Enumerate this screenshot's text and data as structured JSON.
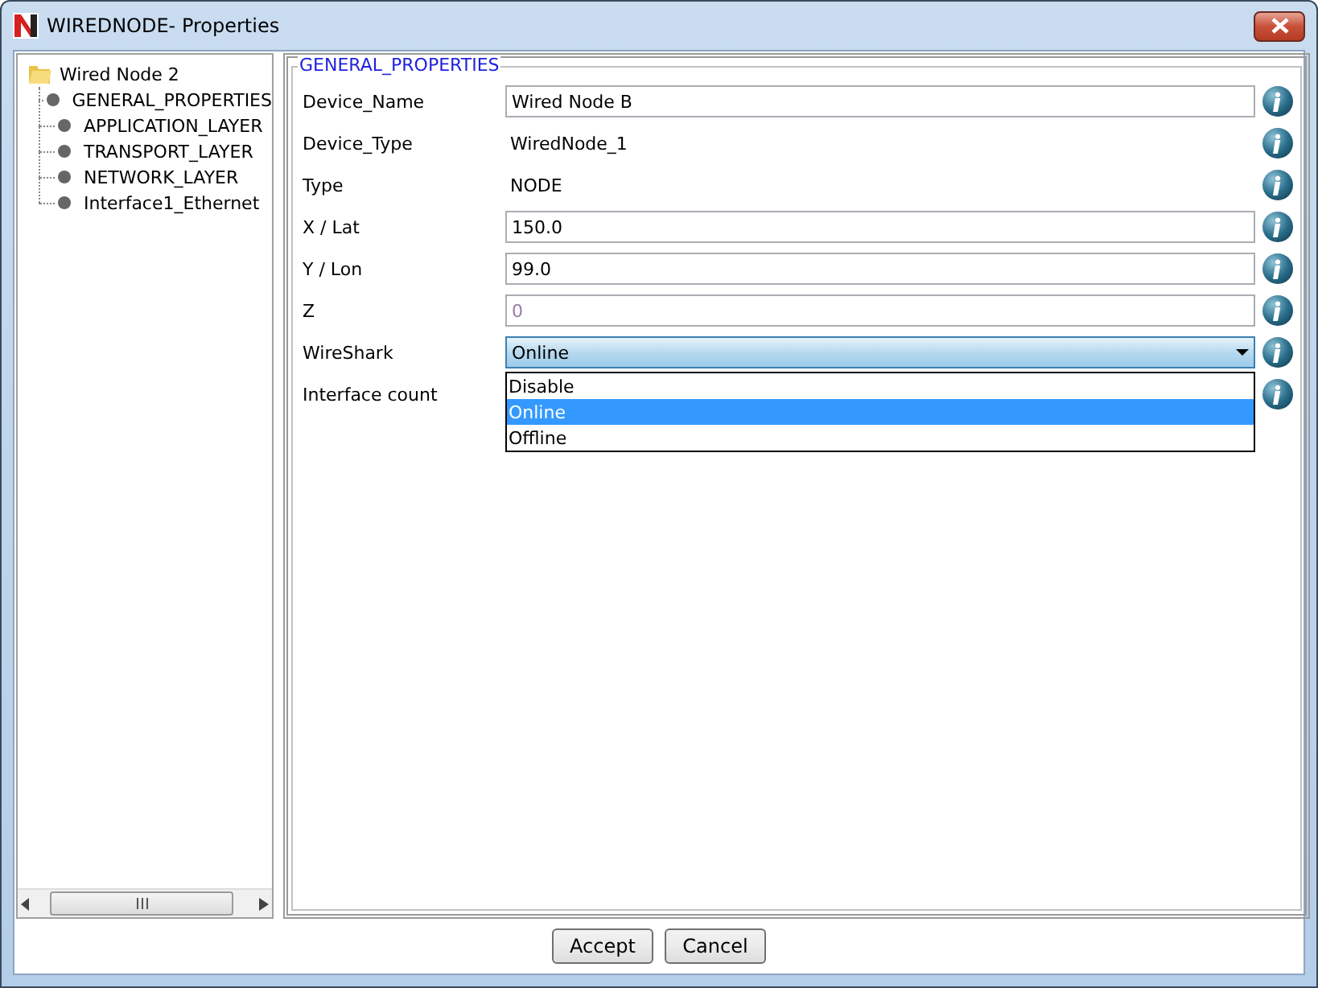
{
  "window": {
    "title": "WIREDNODE- Properties"
  },
  "tree": {
    "label": "Wired Node 2",
    "expanded": true,
    "children": [
      {
        "label": "GENERAL_PROPERTIES"
      },
      {
        "label": "APPLICATION_LAYER"
      },
      {
        "label": "TRANSPORT_LAYER"
      },
      {
        "label": "NETWORK_LAYER"
      },
      {
        "label": "Interface1_Ethernet"
      }
    ]
  },
  "group": {
    "legend": "GENERAL_PROPERTIES",
    "rows": [
      {
        "label": "Device_Name",
        "kind": "input",
        "value": "Wired Node B"
      },
      {
        "label": "Device_Type",
        "kind": "text",
        "value": "WiredNode_1"
      },
      {
        "label": "Type",
        "kind": "text",
        "value": "NODE"
      },
      {
        "label": "X / Lat",
        "kind": "input",
        "value": "150.0"
      },
      {
        "label": "Y / Lon",
        "kind": "input",
        "value": "99.0"
      },
      {
        "label": "Z",
        "kind": "disabled",
        "value": "0"
      },
      {
        "label": "WireShark",
        "kind": "dropdown",
        "value": "Online",
        "expanded": true,
        "options": [
          {
            "label": "Disable",
            "selected": false
          },
          {
            "label": "Online",
            "selected": true
          },
          {
            "label": "Offline",
            "selected": false
          }
        ]
      },
      {
        "label": "Interface count",
        "kind": "empty"
      }
    ]
  },
  "buttons": [
    "Accept",
    "Cancel"
  ]
}
